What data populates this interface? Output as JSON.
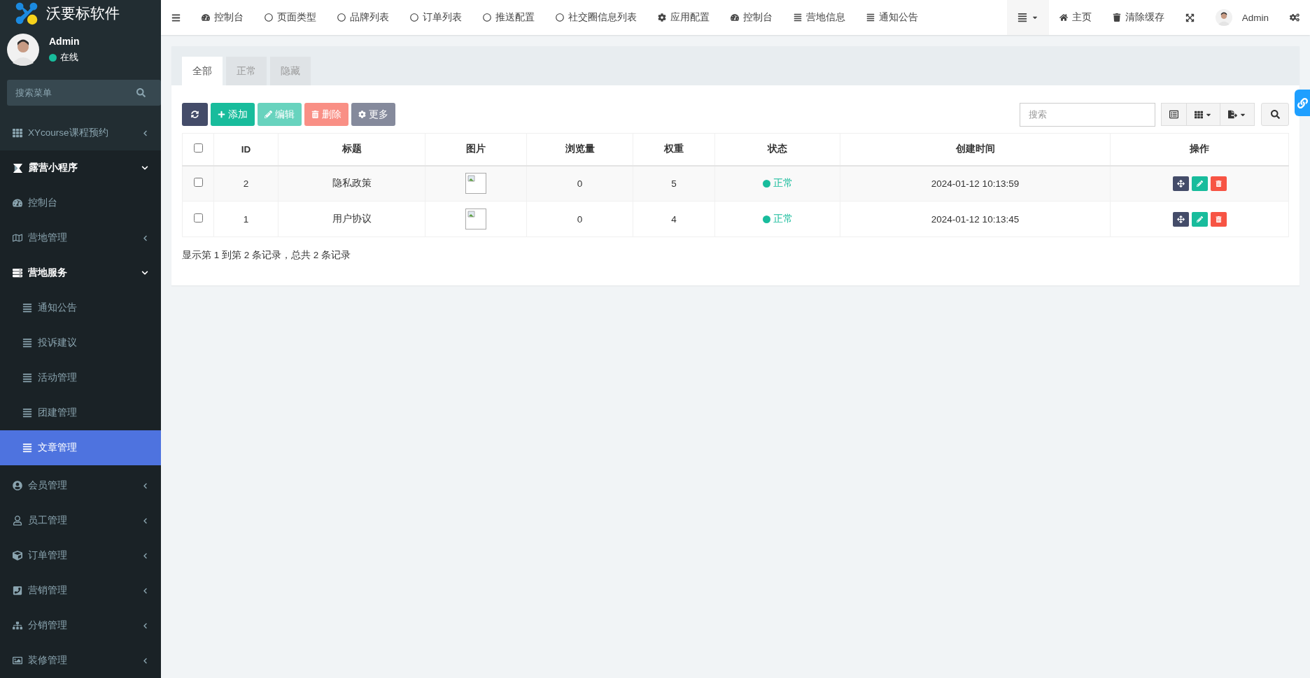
{
  "sidebar": {
    "brand": "沃要标软件",
    "user": {
      "name": "Admin",
      "status": "在线",
      "online": true
    },
    "search": {
      "placeholder": "搜索菜单"
    },
    "menu": [
      {
        "label": "XYcourse课程预约",
        "kind": "grid",
        "expanded": false,
        "selected": false
      },
      {
        "label": "露营小程序",
        "kind": "logo",
        "expanded": true,
        "selected": false,
        "children": [
          {
            "label": "控制台",
            "kind": "dashboard",
            "selected": false
          },
          {
            "label": "营地管理",
            "kind": "map",
            "expanded": false,
            "selected": false
          },
          {
            "label": "营地服务",
            "kind": "server",
            "expanded": true,
            "selected": false,
            "children": [
              {
                "label": "通知公告",
                "kind": "list",
                "selected": false
              },
              {
                "label": "投诉建议",
                "kind": "list",
                "selected": false
              },
              {
                "label": "活动管理",
                "kind": "list",
                "selected": false
              },
              {
                "label": "团建管理",
                "kind": "list",
                "selected": false
              },
              {
                "label": "文章管理",
                "kind": "list",
                "selected": true
              }
            ]
          },
          {
            "label": "会员管理",
            "kind": "member",
            "expanded": false,
            "selected": false
          },
          {
            "label": "员工管理",
            "kind": "staff",
            "expanded": false,
            "selected": false
          },
          {
            "label": "订单管理",
            "kind": "cube",
            "expanded": false,
            "selected": false
          },
          {
            "label": "营销管理",
            "kind": "phone",
            "expanded": false,
            "selected": false
          },
          {
            "label": "分销管理",
            "kind": "sitemap",
            "expanded": false,
            "selected": false
          },
          {
            "label": "装修管理",
            "kind": "image",
            "expanded": false,
            "selected": false
          }
        ]
      }
    ]
  },
  "topnav": {
    "items": [
      {
        "kind": "dashboard",
        "label": "控制台"
      },
      {
        "kind": "circle",
        "label": "页面类型"
      },
      {
        "kind": "circle",
        "label": "品牌列表"
      },
      {
        "kind": "circle",
        "label": "订单列表"
      },
      {
        "kind": "circle",
        "label": "推送配置"
      },
      {
        "kind": "circle",
        "label": "社交圈信息列表"
      },
      {
        "kind": "cog",
        "label": "应用配置"
      },
      {
        "kind": "dashboard",
        "label": "控制台"
      },
      {
        "kind": "list",
        "label": "营地信息"
      },
      {
        "kind": "list",
        "label": "通知公告"
      }
    ],
    "right": [
      {
        "kind": "home",
        "label": "主页"
      },
      {
        "kind": "trash",
        "label": "清除缓存"
      }
    ],
    "user": "Admin"
  },
  "tabs": [
    {
      "label": "全部",
      "selected": true
    },
    {
      "label": "正常",
      "selected": false
    },
    {
      "label": "隐藏",
      "selected": false
    }
  ],
  "toolbar": {
    "buttons": [
      {
        "kind": "refresh",
        "disabled": false
      },
      {
        "kind": "add",
        "label": "添加",
        "disabled": false
      },
      {
        "kind": "edit",
        "label": "编辑",
        "disabled": true
      },
      {
        "kind": "delete",
        "label": "删除",
        "disabled": true
      },
      {
        "kind": "more",
        "label": "更多",
        "disabled": false
      }
    ],
    "search": {
      "placeholder": "搜索"
    }
  },
  "table": {
    "select_all": {
      "checked": false
    },
    "columns": [
      "ID",
      "标题",
      "图片",
      "浏览量",
      "权重",
      "状态",
      "创建时间",
      "操作"
    ],
    "rows": [
      {
        "checked": false,
        "id": "2",
        "title": "隐私政策",
        "views": "0",
        "weight": "5",
        "status": "正常",
        "created": "2024-01-12 10:13:59"
      },
      {
        "checked": false,
        "id": "1",
        "title": "用户协议",
        "views": "0",
        "weight": "4",
        "status": "正常",
        "created": "2024-01-12 10:13:45"
      }
    ]
  },
  "pagination": "显示第 1 到第 2 条记录，总共 2 条记录"
}
